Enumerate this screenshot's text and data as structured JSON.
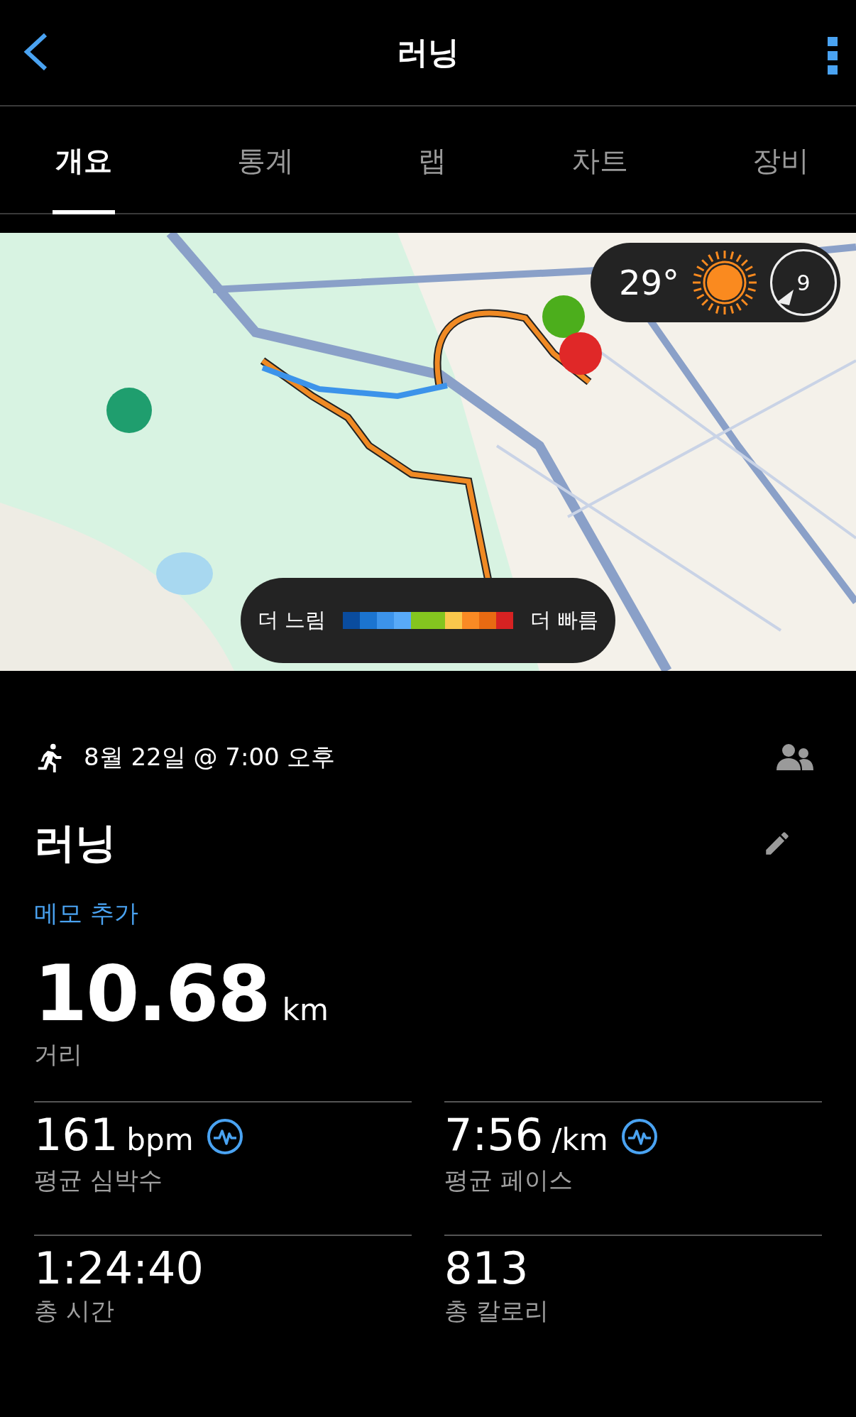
{
  "header": {
    "title": "러닝"
  },
  "tabs": [
    {
      "label": "개요",
      "selected": true
    },
    {
      "label": "통계",
      "selected": false
    },
    {
      "label": "랩",
      "selected": false
    },
    {
      "label": "차트",
      "selected": false
    },
    {
      "label": "장비",
      "selected": false
    }
  ],
  "weather": {
    "temperature": "29°",
    "wind_speed": "9"
  },
  "pace_legend": {
    "slow_label": "더 느림",
    "fast_label": "더 빠름",
    "segments": [
      {
        "color": "#0a4c9e"
      },
      {
        "color": "#1b74d0"
      },
      {
        "color": "#3c93ea"
      },
      {
        "color": "#58aaf8"
      },
      {
        "color": "#84c51f"
      },
      {
        "color": "#84c51f"
      },
      {
        "color": "#fac84c"
      },
      {
        "color": "#f98a24"
      },
      {
        "color": "#e86a12"
      },
      {
        "color": "#d62222"
      }
    ]
  },
  "activity": {
    "date": "8월 22일 @ 7:00 오후",
    "title": "러닝",
    "memo_link": "메모 추가",
    "distance": {
      "value": "10.68",
      "unit": "km",
      "label": "거리"
    }
  },
  "stats": [
    {
      "value": "161",
      "unit": "bpm",
      "label": "평균 심박수",
      "kind": "chart"
    },
    {
      "value": "7:56",
      "unit": "/km",
      "label": "평균 페이스",
      "kind": "chart"
    },
    {
      "value": "1:24:40",
      "label": "총 시간",
      "kind": "plain"
    },
    {
      "value": "813",
      "label": "총 칼로리",
      "kind": "plain"
    }
  ]
}
